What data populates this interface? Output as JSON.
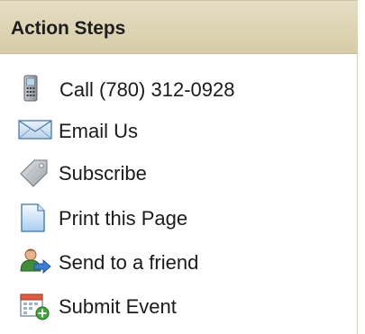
{
  "panel": {
    "title": "Action Steps"
  },
  "items": [
    {
      "label": "Call (780) 312-0928",
      "icon": "mobile-phone-icon"
    },
    {
      "label": "Email Us",
      "icon": "envelope-icon"
    },
    {
      "label": "Subscribe",
      "icon": "tag-icon"
    },
    {
      "label": "Print this Page",
      "icon": "document-icon"
    },
    {
      "label": "Send to a friend",
      "icon": "user-send-icon"
    },
    {
      "label": "Submit Event",
      "icon": "calendar-add-icon"
    }
  ],
  "colors": {
    "header_bg_top": "#e6dec5",
    "header_bg_bottom": "#d6cca6",
    "text": "#1b1b1b",
    "border": "#d7d1c4"
  }
}
